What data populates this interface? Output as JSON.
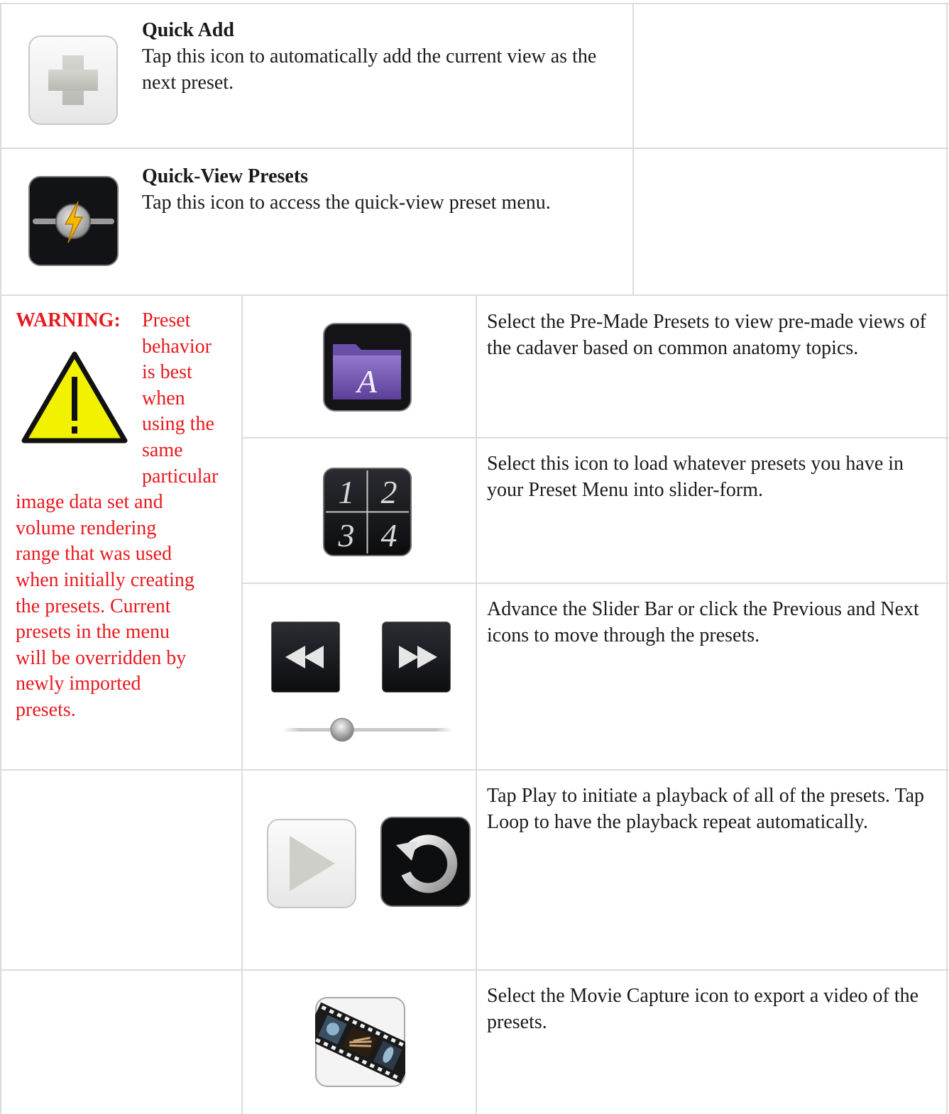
{
  "rows": {
    "quick_add": {
      "title": "Quick Add",
      "description": "Tap this icon to automatically add the current view as the next preset.",
      "icon": "plus-icon"
    },
    "quick_view": {
      "title": "Quick-View Presets",
      "description": "Tap this icon to access the quick-view preset menu.",
      "icon": "lightning-icon"
    },
    "warning": {
      "label": "WARNING:",
      "narrow_lines": [
        "Preset",
        "behavior",
        "is best",
        "when",
        "using the",
        "same",
        "particular"
      ],
      "wide_lines": [
        "image data set and",
        "volume rendering",
        "range that was used",
        "when initially creating",
        "the presets. Current",
        "presets in the menu",
        "will be overridden by",
        "newly imported",
        "presets."
      ],
      "icon": "warning-triangle-icon"
    },
    "premade": {
      "description": "Select the Pre-Made Presets to view pre-made views of the cadaver based on common anatomy topics.",
      "icon": "folder-icon",
      "icon_letter": "A"
    },
    "slider_form": {
      "description": "Select this icon to load whatever presets you have in your Preset Menu into slider-form.",
      "icon": "numbered-grid-icon",
      "digits": [
        "1",
        "2",
        "3",
        "4"
      ]
    },
    "advance": {
      "description": "Advance the Slider Bar or click the Previous and Next icons to move through the presets.",
      "icons": [
        "rewind-icon",
        "fast-forward-icon",
        "slider-icon"
      ]
    },
    "playback": {
      "description": "Tap Play to initiate a playback of all of the presets. Tap Loop to have the playback repeat automatically.",
      "icons": [
        "play-icon",
        "loop-icon"
      ]
    },
    "movie": {
      "description": "Select the Movie Capture icon to export a video of the presets.",
      "icon": "film-strip-icon"
    }
  },
  "colors": {
    "border": "#dcdcdc",
    "warning_text": "#e8191e",
    "folder_purple": "#7c5cb8",
    "bolt": "#f5b800"
  }
}
